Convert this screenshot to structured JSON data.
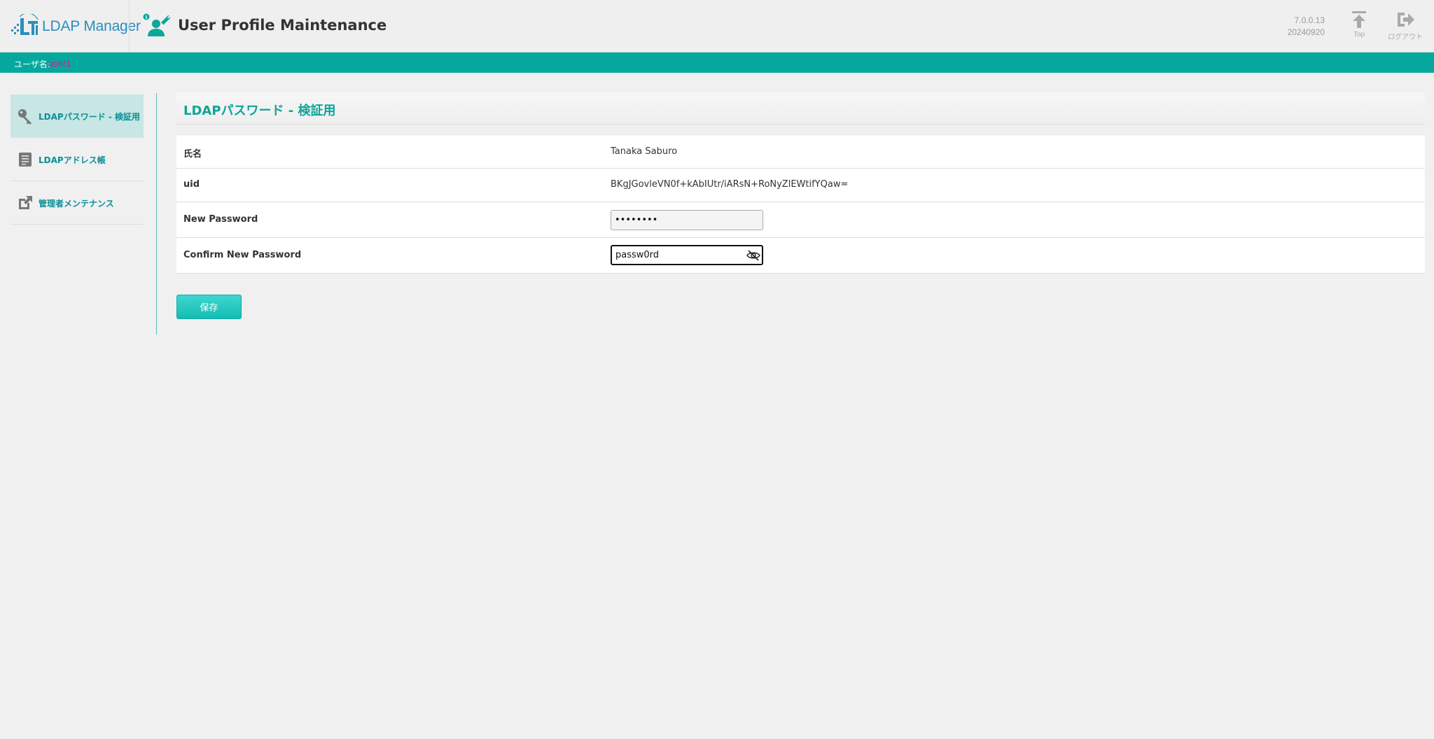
{
  "header": {
    "logo_text": "LDAP Manager",
    "app_title": "User Profile Maintenance",
    "version": "7.0.0.13",
    "build": "20240920",
    "top_label": "Top",
    "logout_label": "ログアウト"
  },
  "userbar": {
    "label": "ユーザ名:",
    "username": "user1"
  },
  "sidebar": {
    "items": [
      {
        "label": "LDAPパスワード - 検証用",
        "icon": "key-icon",
        "active": true
      },
      {
        "label": "LDAPアドレス帳",
        "icon": "address-book-icon",
        "active": false
      },
      {
        "label": "管理者メンテナンス",
        "icon": "external-link-icon",
        "active": false
      }
    ]
  },
  "panel": {
    "title": "LDAPパスワード - 検証用",
    "rows": [
      {
        "label": "氏名",
        "value": "Tanaka Saburo"
      },
      {
        "label": "uid",
        "value": "BKgJGovleVN0f+kAbIUtr/iARsN+RoNyZlEWtifYQaw="
      },
      {
        "label": "New Password",
        "value": "password"
      },
      {
        "label": "Confirm New Password",
        "value": "passw0rd"
      }
    ],
    "save_label": "保存"
  },
  "colors": {
    "accent": "#05a89d",
    "title": "#0fa497",
    "username": "#e0198c"
  }
}
